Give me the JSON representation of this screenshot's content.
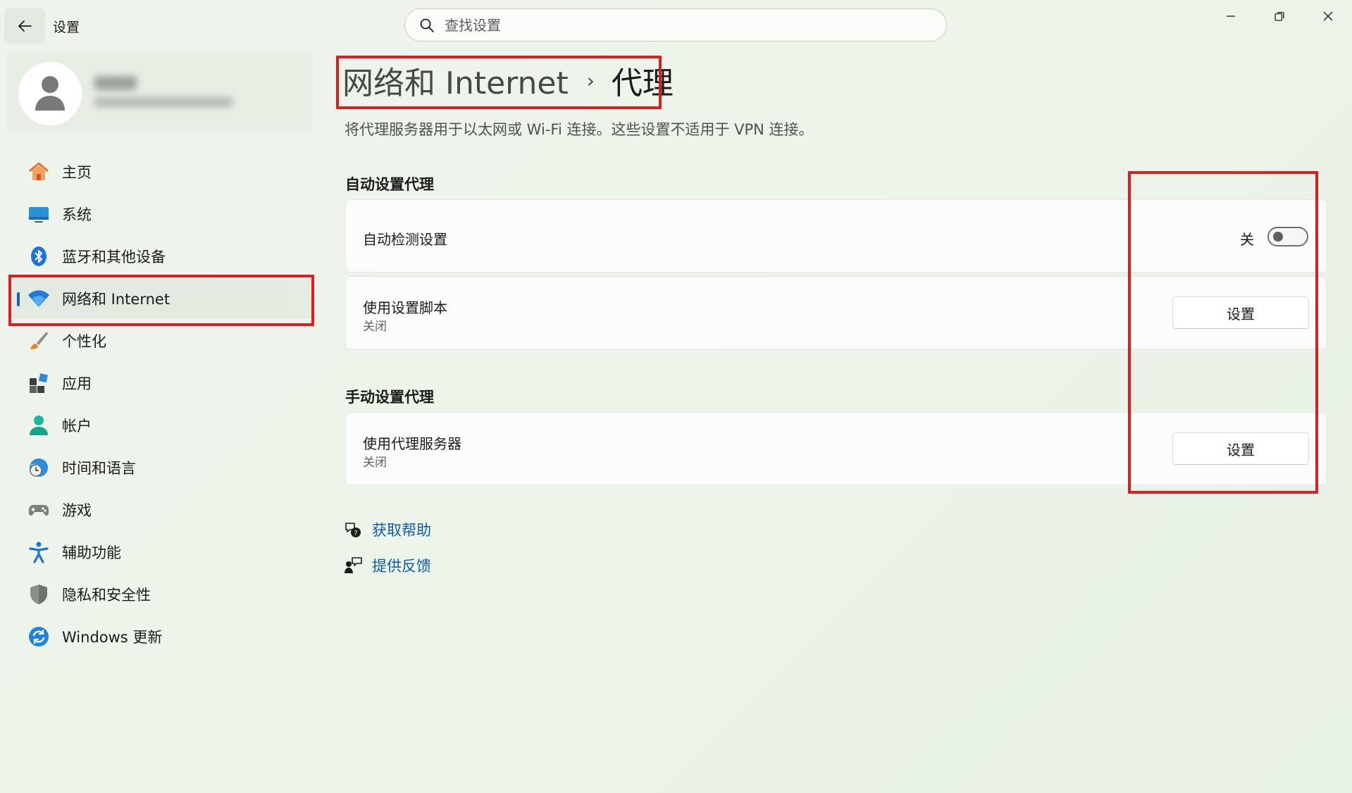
{
  "window": {
    "title": "设置",
    "back_icon": "arrow-left-icon",
    "controls": [
      "minimize-icon",
      "maximize-icon",
      "close-icon"
    ]
  },
  "search": {
    "placeholder": "查找设置",
    "icon": "search-icon"
  },
  "profile": {
    "avatar_icon": "person-icon"
  },
  "sidebar": {
    "items": [
      {
        "label": "主页",
        "icon": "home-icon",
        "active": false
      },
      {
        "label": "系统",
        "icon": "monitor-icon",
        "active": false
      },
      {
        "label": "蓝牙和其他设备",
        "icon": "bluetooth-icon",
        "active": false
      },
      {
        "label": "网络和 Internet",
        "icon": "wifi-icon",
        "active": true
      },
      {
        "label": "个性化",
        "icon": "brush-icon",
        "active": false
      },
      {
        "label": "应用",
        "icon": "apps-icon",
        "active": false
      },
      {
        "label": "帐户",
        "icon": "account-icon",
        "active": false
      },
      {
        "label": "时间和语言",
        "icon": "globe-clock-icon",
        "active": false
      },
      {
        "label": "游戏",
        "icon": "gamepad-icon",
        "active": false
      },
      {
        "label": "辅助功能",
        "icon": "accessibility-icon",
        "active": false
      },
      {
        "label": "隐私和安全性",
        "icon": "shield-icon",
        "active": false
      },
      {
        "label": "Windows 更新",
        "icon": "update-icon",
        "active": false
      }
    ]
  },
  "main": {
    "breadcrumb": {
      "parent": "网络和 Internet",
      "separator": "›",
      "current": "代理"
    },
    "description": "将代理服务器用于以太网或 Wi-Fi 连接。这些设置不适用于 VPN 连接。",
    "auto_section": {
      "title": "自动设置代理",
      "detect": {
        "title": "自动检测设置",
        "toggle_label": "关",
        "toggle_on": false
      },
      "script": {
        "title": "使用设置脚本",
        "subtitle": "关闭",
        "button": "设置"
      }
    },
    "manual_section": {
      "title": "手动设置代理",
      "proxy": {
        "title": "使用代理服务器",
        "subtitle": "关闭",
        "button": "设置"
      }
    },
    "links": [
      {
        "label": "获取帮助",
        "icon": "help-chat-icon"
      },
      {
        "label": "提供反馈",
        "icon": "feedback-icon"
      }
    ]
  },
  "colors": {
    "accent": "#1a60b4",
    "highlight": "#d7201f",
    "link": "#0f5aa8"
  }
}
